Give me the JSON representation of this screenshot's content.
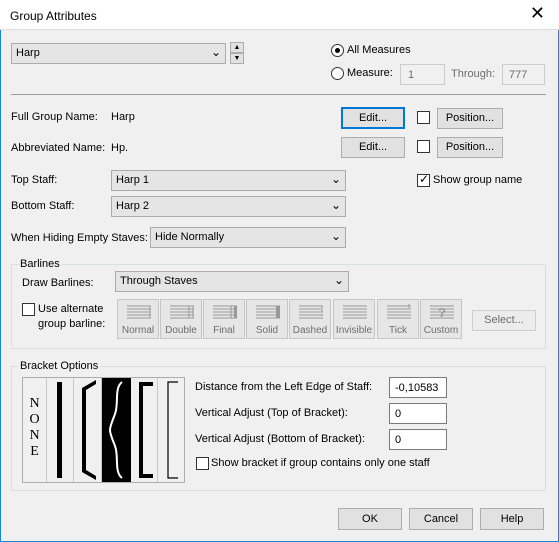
{
  "window": {
    "title": "Group Attributes",
    "close_glyph": "✕"
  },
  "group_select": {
    "value": "Harp"
  },
  "measures": {
    "all_label": "All Measures",
    "measure_label": "Measure:",
    "measure_from": "1",
    "through_label": "Through:",
    "measure_to": "777",
    "selected": "all"
  },
  "names": {
    "full_label": "Full Group Name:",
    "full_value": "Harp",
    "abbr_label": "Abbreviated Name:",
    "abbr_value": "Hp.",
    "edit_label": "Edit...",
    "position_label": "Position..."
  },
  "staves": {
    "top_label": "Top Staff:",
    "top_value": "Harp 1",
    "bottom_label": "Bottom Staff:",
    "bottom_value": "Harp 2",
    "show_group_name_label": "Show group name",
    "show_group_name": true,
    "hiding_label": "When Hiding Empty Staves:",
    "hiding_value": "Hide Normally"
  },
  "barlines": {
    "group_label": "Barlines",
    "draw_label": "Draw Barlines:",
    "draw_value": "Through Staves",
    "alternate_label_1": "Use alternate",
    "alternate_label_2": "group barline:",
    "styles": [
      "Normal",
      "Double",
      "Final",
      "Solid",
      "Dashed",
      "Invisible",
      "Tick",
      "Custom"
    ],
    "select_label": "Select..."
  },
  "bracket": {
    "group_label": "Bracket Options",
    "none_letters": [
      "N",
      "O",
      "N",
      "E"
    ],
    "distance_label": "Distance from the Left Edge of Staff:",
    "distance_value": "-0,10583",
    "vtop_label": "Vertical Adjust (Top of Bracket):",
    "vtop_value": "0",
    "vbottom_label": "Vertical Adjust (Bottom of Bracket):",
    "vbottom_value": "0",
    "show_one_staff_label": "Show bracket if group contains only one staff"
  },
  "footer": {
    "ok": "OK",
    "cancel": "Cancel",
    "help": "Help"
  }
}
